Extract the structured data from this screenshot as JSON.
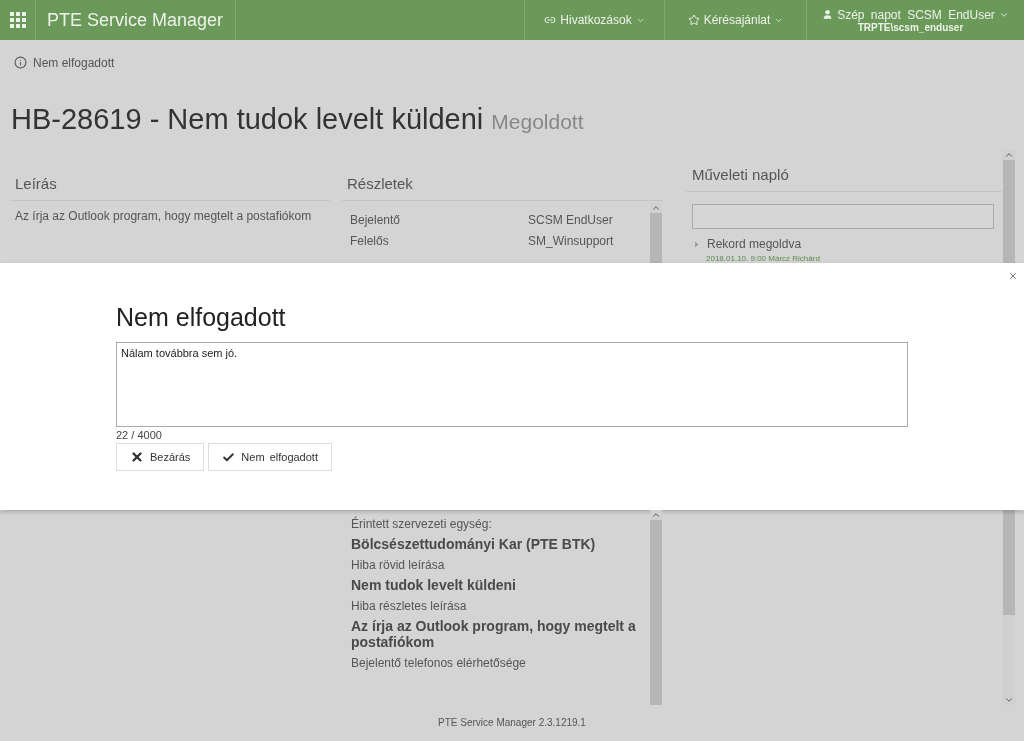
{
  "header": {
    "app_title": "PTE Service Manager",
    "nav": [
      {
        "label": "Hivatkozások"
      },
      {
        "label": "Kérésajánlat"
      }
    ],
    "user": {
      "greeting": "Szép napot SCSM EndUser",
      "account": "TRPTE\\scsm_enduser"
    }
  },
  "breadcrumb": "Nem elfogadott",
  "title": {
    "subject": "HB-28619 - Nem tudok levelt küldeni",
    "status": "Megoldott"
  },
  "description_panel": {
    "heading": "Leírás",
    "text": "Az írja az Outlook program, hogy megtelt a postafiókom"
  },
  "details_panel": {
    "heading": "Részletek",
    "rows": [
      {
        "label": "Bejelentő",
        "value": "SCSM EndUser"
      },
      {
        "label": "Felelős",
        "value": "SM_Winsupport"
      }
    ],
    "fields": [
      {
        "label": "Érintett szervezeti egység:",
        "value": "Bölcsészettudományi Kar (PTE BTK)"
      },
      {
        "label": "Hiba rövid leírása",
        "value": "Nem tudok levelt küldeni"
      },
      {
        "label": "Hiba részletes leírása",
        "value": "Az írja az Outlook program, hogy megtelt a postafiókom"
      },
      {
        "label": "Bejelentő telefonos elérhetősége"
      }
    ]
  },
  "activity_log": {
    "heading": "Műveleti napló",
    "entries": [
      {
        "title": "Rekord megoldva",
        "meta": "2018.01.10. 9:00 Márcz Richárd"
      }
    ]
  },
  "dialog": {
    "title": "Nem elfogadott",
    "comment": "Nálam továbbra sem jó.",
    "counter": "22 / 4000",
    "buttons": [
      {
        "label": "Bezárás",
        "kind": "close"
      },
      {
        "label": "Nem  elfogadott",
        "kind": "confirm"
      }
    ]
  },
  "footer": "PTE Service Manager 2.3.1219.1"
}
